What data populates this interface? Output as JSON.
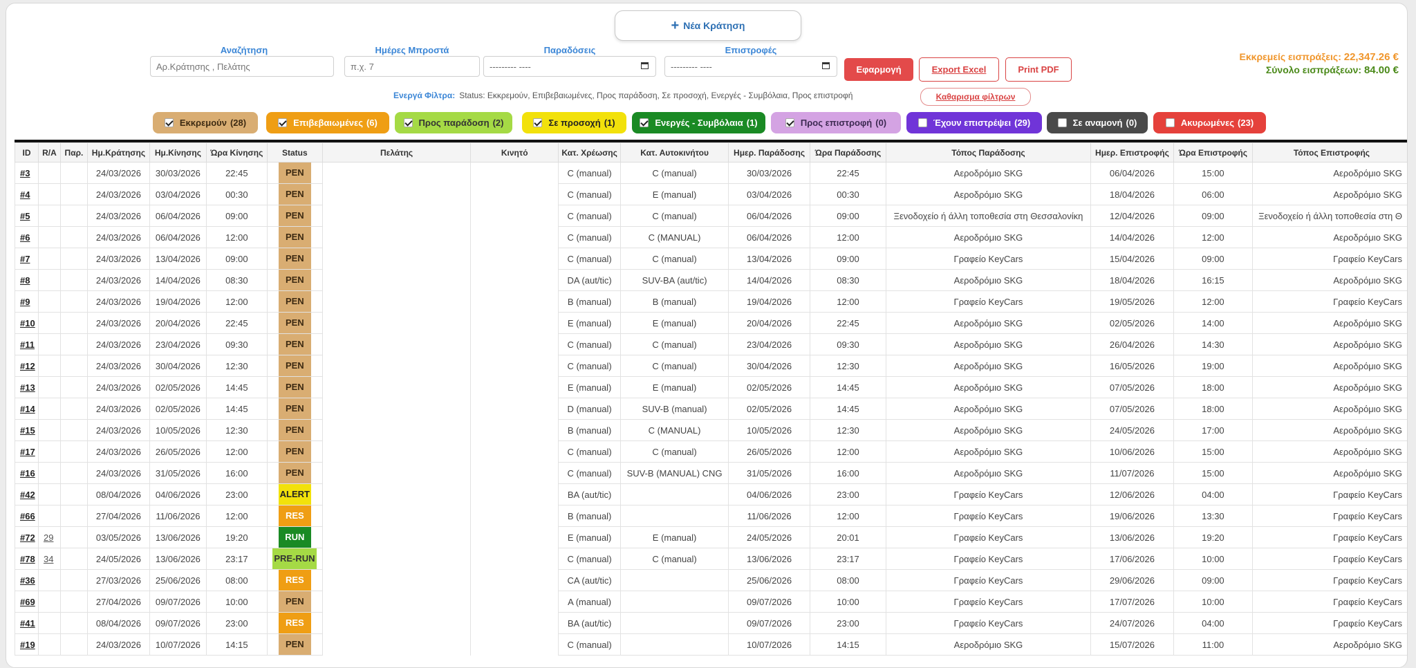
{
  "new_booking": {
    "label": "Νέα Κράτηση"
  },
  "filters": {
    "search": {
      "label": "Αναζήτηση",
      "placeholder": "Αρ.Κράτησης , Πελάτης"
    },
    "days_ahead": {
      "label": "Ημέρες Μπροστά",
      "placeholder": "π.χ. 7"
    },
    "deliveries": {
      "label": "Παραδόσεις",
      "value": "--------- ----"
    },
    "returns": {
      "label": "Επιστροφές",
      "value": "--------- ----"
    }
  },
  "actions": {
    "apply": "Εφαρμογή",
    "export_excel": "Export Excel",
    "print_pdf": "Print PDF"
  },
  "totals": {
    "pending_label": "Εκκρεμείς εισπράξεις:",
    "pending_value": "22,347.26 €",
    "collected_label": "Σύνολο εισπράξεων:",
    "collected_value": "84.00 €"
  },
  "active_filters": {
    "label": "Ενεργά Φίλτρα:",
    "text": "Status: Εκκρεμούν, Επιβεβαιωμένες, Προς παράδοση, Σε προσοχή, Ενεργές - Συμβόλαια, Προς επιστροφή",
    "clear": "Καθαρισμα φίλτρων"
  },
  "chips": [
    {
      "label": "Εκκρεμούν",
      "count": "(28)",
      "checked": true,
      "bg": "#d9ad72",
      "fg": "#3d2a12"
    },
    {
      "label": "Επιβεβαιωμένες",
      "count": "(6)",
      "checked": true,
      "bg": "#ef9e14",
      "fg": "#ffffff"
    },
    {
      "label": "Προς παράδοση",
      "count": "(2)",
      "checked": true,
      "bg": "#a5da45",
      "fg": "#333333"
    },
    {
      "label": "Σε προσοχή",
      "count": "(1)",
      "checked": true,
      "bg": "#f2e10b",
      "fg": "#222222"
    },
    {
      "label": "Ενεργές - Συμβόλαια",
      "count": "(1)",
      "checked": true,
      "bg": "#1a8a24",
      "fg": "#ffffff"
    },
    {
      "label": "Προς επιστροφή",
      "count": "(0)",
      "checked": true,
      "bg": "#d4a3e3",
      "fg": "#3d2a52"
    },
    {
      "label": "Έχουν επιστρέψει",
      "count": "(29)",
      "checked": false,
      "bg": "#7034d8",
      "fg": "#ffffff"
    },
    {
      "label": "Σε αναμονή",
      "count": "(0)",
      "checked": false,
      "bg": "#4a4a4a",
      "fg": "#ffffff"
    },
    {
      "label": "Ακυρωμένες",
      "count": "(23)",
      "checked": false,
      "bg": "#e5413b",
      "fg": "#ffffff"
    }
  ],
  "table": {
    "headers": [
      "ID",
      "R/A",
      "Παρ.",
      "Ημ.Κράτησης",
      "Ημ.Κίνησης",
      "Ώρα Κίνησης",
      "Status",
      "Πελάτης",
      "Κινητό",
      "Κατ. Χρέωσης",
      "Κατ. Αυτοκινήτου",
      "Ημερ. Παράδοσης",
      "Ώρα Παράδοσης",
      "Τόπος Παράδοσης",
      "Ημερ. Επιστροφής",
      "Ώρα Επιστροφής",
      "Τόπος Επιστροφής"
    ],
    "rows": [
      {
        "id": "#3",
        "ra": "",
        "bdate": "24/03/2026",
        "mdate": "30/03/2026",
        "mtime": "22:45",
        "status": "PEN",
        "charge": "C (manual)",
        "car": "C (manual)",
        "ddate": "30/03/2026",
        "dtime": "22:45",
        "dloc": "Αεροδρόμιο SKG",
        "rdate": "06/04/2026",
        "rtime": "15:00",
        "rloc": "Αεροδρόμιο SKG"
      },
      {
        "id": "#4",
        "ra": "",
        "bdate": "24/03/2026",
        "mdate": "03/04/2026",
        "mtime": "00:30",
        "status": "PEN",
        "charge": "C (manual)",
        "car": "E (manual)",
        "ddate": "03/04/2026",
        "dtime": "00:30",
        "dloc": "Αεροδρόμιο SKG",
        "rdate": "18/04/2026",
        "rtime": "06:00",
        "rloc": "Αεροδρόμιο SKG"
      },
      {
        "id": "#5",
        "ra": "",
        "bdate": "24/03/2026",
        "mdate": "06/04/2026",
        "mtime": "09:00",
        "status": "PEN",
        "charge": "C (manual)",
        "car": "C (manual)",
        "ddate": "06/04/2026",
        "dtime": "09:00",
        "dloc": "Ξενοδοχείο ή άλλη τοποθεσία στη Θεσσαλονίκη",
        "rdate": "12/04/2026",
        "rtime": "09:00",
        "rloc": "Ξενοδοχείο ή άλλη τοποθεσία στη Θ"
      },
      {
        "id": "#6",
        "ra": "",
        "bdate": "24/03/2026",
        "mdate": "06/04/2026",
        "mtime": "12:00",
        "status": "PEN",
        "charge": "C (manual)",
        "car": "C (MANUAL)",
        "ddate": "06/04/2026",
        "dtime": "12:00",
        "dloc": "Αεροδρόμιο SKG",
        "rdate": "14/04/2026",
        "rtime": "12:00",
        "rloc": "Αεροδρόμιο SKG"
      },
      {
        "id": "#7",
        "ra": "",
        "bdate": "24/03/2026",
        "mdate": "13/04/2026",
        "mtime": "09:00",
        "status": "PEN",
        "charge": "C (manual)",
        "car": "C (manual)",
        "ddate": "13/04/2026",
        "dtime": "09:00",
        "dloc": "Γραφείο KeyCars",
        "rdate": "15/04/2026",
        "rtime": "09:00",
        "rloc": "Γραφείο KeyCars"
      },
      {
        "id": "#8",
        "ra": "",
        "bdate": "24/03/2026",
        "mdate": "14/04/2026",
        "mtime": "08:30",
        "status": "PEN",
        "charge": "DA (aut/tic)",
        "car": "SUV-BA (aut/tic)",
        "ddate": "14/04/2026",
        "dtime": "08:30",
        "dloc": "Αεροδρόμιο SKG",
        "rdate": "18/04/2026",
        "rtime": "16:15",
        "rloc": "Αεροδρόμιο SKG"
      },
      {
        "id": "#9",
        "ra": "",
        "bdate": "24/03/2026",
        "mdate": "19/04/2026",
        "mtime": "12:00",
        "status": "PEN",
        "charge": "B (manual)",
        "car": "B (manual)",
        "ddate": "19/04/2026",
        "dtime": "12:00",
        "dloc": "Γραφείο KeyCars",
        "rdate": "19/05/2026",
        "rtime": "12:00",
        "rloc": "Γραφείο KeyCars"
      },
      {
        "id": "#10",
        "ra": "",
        "bdate": "24/03/2026",
        "mdate": "20/04/2026",
        "mtime": "22:45",
        "status": "PEN",
        "charge": "E (manual)",
        "car": "E (manual)",
        "ddate": "20/04/2026",
        "dtime": "22:45",
        "dloc": "Αεροδρόμιο SKG",
        "rdate": "02/05/2026",
        "rtime": "14:00",
        "rloc": "Αεροδρόμιο SKG"
      },
      {
        "id": "#11",
        "ra": "",
        "bdate": "24/03/2026",
        "mdate": "23/04/2026",
        "mtime": "09:30",
        "status": "PEN",
        "charge": "C (manual)",
        "car": "C (manual)",
        "ddate": "23/04/2026",
        "dtime": "09:30",
        "dloc": "Αεροδρόμιο SKG",
        "rdate": "26/04/2026",
        "rtime": "14:30",
        "rloc": "Αεροδρόμιο SKG"
      },
      {
        "id": "#12",
        "ra": "",
        "bdate": "24/03/2026",
        "mdate": "30/04/2026",
        "mtime": "12:30",
        "status": "PEN",
        "charge": "C (manual)",
        "car": "C (manual)",
        "ddate": "30/04/2026",
        "dtime": "12:30",
        "dloc": "Αεροδρόμιο SKG",
        "rdate": "16/05/2026",
        "rtime": "19:00",
        "rloc": "Αεροδρόμιο SKG"
      },
      {
        "id": "#13",
        "ra": "",
        "bdate": "24/03/2026",
        "mdate": "02/05/2026",
        "mtime": "14:45",
        "status": "PEN",
        "charge": "E (manual)",
        "car": "E (manual)",
        "ddate": "02/05/2026",
        "dtime": "14:45",
        "dloc": "Αεροδρόμιο SKG",
        "rdate": "07/05/2026",
        "rtime": "18:00",
        "rloc": "Αεροδρόμιο SKG"
      },
      {
        "id": "#14",
        "ra": "",
        "bdate": "24/03/2026",
        "mdate": "02/05/2026",
        "mtime": "14:45",
        "status": "PEN",
        "charge": "D (manual)",
        "car": "SUV-B (manual)",
        "ddate": "02/05/2026",
        "dtime": "14:45",
        "dloc": "Αεροδρόμιο SKG",
        "rdate": "07/05/2026",
        "rtime": "18:00",
        "rloc": "Αεροδρόμιο SKG"
      },
      {
        "id": "#15",
        "ra": "",
        "bdate": "24/03/2026",
        "mdate": "10/05/2026",
        "mtime": "12:30",
        "status": "PEN",
        "charge": "B (manual)",
        "car": "C (MANUAL)",
        "ddate": "10/05/2026",
        "dtime": "12:30",
        "dloc": "Αεροδρόμιο SKG",
        "rdate": "24/05/2026",
        "rtime": "17:00",
        "rloc": "Αεροδρόμιο SKG"
      },
      {
        "id": "#17",
        "ra": "",
        "bdate": "24/03/2026",
        "mdate": "26/05/2026",
        "mtime": "12:00",
        "status": "PEN",
        "charge": "C (manual)",
        "car": "C (manual)",
        "ddate": "26/05/2026",
        "dtime": "12:00",
        "dloc": "Αεροδρόμιο SKG",
        "rdate": "10/06/2026",
        "rtime": "15:00",
        "rloc": "Αεροδρόμιο SKG"
      },
      {
        "id": "#16",
        "ra": "",
        "bdate": "24/03/2026",
        "mdate": "31/05/2026",
        "mtime": "16:00",
        "status": "PEN",
        "charge": "C (manual)",
        "car": "SUV-B (MANUAL) CNG",
        "ddate": "31/05/2026",
        "dtime": "16:00",
        "dloc": "Αεροδρόμιο SKG",
        "rdate": "11/07/2026",
        "rtime": "15:00",
        "rloc": "Αεροδρόμιο SKG"
      },
      {
        "id": "#42",
        "ra": "",
        "bdate": "08/04/2026",
        "mdate": "04/06/2026",
        "mtime": "23:00",
        "status": "ALERT",
        "charge": "BA (aut/tic)",
        "car": "",
        "ddate": "04/06/2026",
        "dtime": "23:00",
        "dloc": "Γραφείο KeyCars",
        "rdate": "12/06/2026",
        "rtime": "04:00",
        "rloc": "Γραφείο KeyCars"
      },
      {
        "id": "#66",
        "ra": "",
        "bdate": "27/04/2026",
        "mdate": "11/06/2026",
        "mtime": "12:00",
        "status": "RES",
        "charge": "B (manual)",
        "car": "",
        "ddate": "11/06/2026",
        "dtime": "12:00",
        "dloc": "Γραφείο KeyCars",
        "rdate": "19/06/2026",
        "rtime": "13:30",
        "rloc": "Γραφείο KeyCars"
      },
      {
        "id": "#72",
        "ra": "29",
        "bdate": "03/05/2026",
        "mdate": "13/06/2026",
        "mtime": "19:20",
        "status": "RUN",
        "charge": "E (manual)",
        "car": "Ε (manual)",
        "ddate": "24/05/2026",
        "dtime": "20:01",
        "dloc": "Γραφείο KeyCars",
        "rdate": "13/06/2026",
        "rtime": "19:20",
        "rloc": "Γραφείο KeyCars"
      },
      {
        "id": "#78",
        "ra": "34",
        "bdate": "24/05/2026",
        "mdate": "13/06/2026",
        "mtime": "23:17",
        "status": "PRE-RUN",
        "charge": "C (manual)",
        "car": "C (manual)",
        "ddate": "13/06/2026",
        "dtime": "23:17",
        "dloc": "Γραφείο KeyCars",
        "rdate": "17/06/2026",
        "rtime": "10:00",
        "rloc": "Γραφείο KeyCars"
      },
      {
        "id": "#36",
        "ra": "",
        "bdate": "27/03/2026",
        "mdate": "25/06/2026",
        "mtime": "08:00",
        "status": "RES",
        "charge": "CA (aut/tic)",
        "car": "",
        "ddate": "25/06/2026",
        "dtime": "08:00",
        "dloc": "Γραφείο KeyCars",
        "rdate": "29/06/2026",
        "rtime": "09:00",
        "rloc": "Γραφείο KeyCars"
      },
      {
        "id": "#69",
        "ra": "",
        "bdate": "27/04/2026",
        "mdate": "09/07/2026",
        "mtime": "10:00",
        "status": "PEN",
        "charge": "A (manual)",
        "car": "",
        "ddate": "09/07/2026",
        "dtime": "10:00",
        "dloc": "Γραφείο KeyCars",
        "rdate": "17/07/2026",
        "rtime": "10:00",
        "rloc": "Γραφείο KeyCars"
      },
      {
        "id": "#41",
        "ra": "",
        "bdate": "08/04/2026",
        "mdate": "09/07/2026",
        "mtime": "23:00",
        "status": "RES",
        "charge": "BA (aut/tic)",
        "car": "",
        "ddate": "09/07/2026",
        "dtime": "23:00",
        "dloc": "Γραφείο KeyCars",
        "rdate": "24/07/2026",
        "rtime": "04:00",
        "rloc": "Γραφείο KeyCars"
      },
      {
        "id": "#19",
        "ra": "",
        "bdate": "24/03/2026",
        "mdate": "10/07/2026",
        "mtime": "14:15",
        "status": "PEN",
        "charge": "C (manual)",
        "car": "",
        "ddate": "10/07/2026",
        "dtime": "14:15",
        "dloc": "Αεροδρόμιο SKG",
        "rdate": "15/07/2026",
        "rtime": "11:00",
        "rloc": "Αεροδρόμιο SKG"
      }
    ]
  }
}
